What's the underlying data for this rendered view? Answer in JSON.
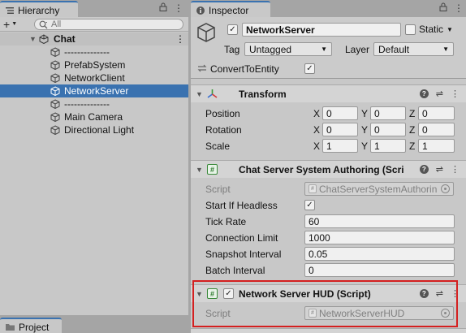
{
  "hierarchy": {
    "tab_label": "Hierarchy",
    "add_label": "+",
    "search_placeholder": "All",
    "scene_name": "Chat",
    "items": [
      {
        "label": "--------------"
      },
      {
        "label": "PrefabSystem"
      },
      {
        "label": "NetworkClient"
      },
      {
        "label": "NetworkServer",
        "selected": true
      },
      {
        "label": "--------------"
      },
      {
        "label": "Main Camera"
      },
      {
        "label": "Directional Light"
      }
    ]
  },
  "project": {
    "tab_label": "Project"
  },
  "inspector": {
    "tab_label": "Inspector",
    "object": {
      "name": "NetworkServer",
      "active": true,
      "static_label": "Static",
      "tag_label": "Tag",
      "tag_value": "Untagged",
      "layer_label": "Layer",
      "layer_value": "Default",
      "convert_label": "ConvertToEntity",
      "convert_checked": true
    },
    "transform": {
      "title": "Transform",
      "position_label": "Position",
      "rotation_label": "Rotation",
      "scale_label": "Scale",
      "axis_x": "X",
      "axis_y": "Y",
      "axis_z": "Z",
      "position": {
        "x": "0",
        "y": "0",
        "z": "0"
      },
      "rotation": {
        "x": "0",
        "y": "0",
        "z": "0"
      },
      "scale": {
        "x": "1",
        "y": "1",
        "z": "1"
      }
    },
    "chat_server": {
      "title": "Chat Server System Authoring (Scri",
      "script_label": "Script",
      "script_value": "ChatServerSystemAuthorin",
      "start_headless_label": "Start If Headless",
      "start_headless_checked": true,
      "tick_rate_label": "Tick Rate",
      "tick_rate_value": "60",
      "connection_limit_label": "Connection Limit",
      "connection_limit_value": "1000",
      "snapshot_interval_label": "Snapshot Interval",
      "snapshot_interval_value": "0.05",
      "batch_interval_label": "Batch Interval",
      "batch_interval_value": "0"
    },
    "server_hud": {
      "title": "Network Server HUD (Script)",
      "enabled": true,
      "script_label": "Script",
      "script_value": "NetworkServerHUD"
    }
  },
  "colors": {
    "selection": "#3a72b0",
    "highlight_border": "#d42020",
    "panel_bg": "#c8c8c8"
  }
}
